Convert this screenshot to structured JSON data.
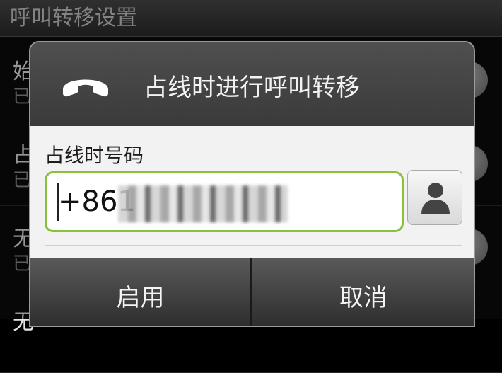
{
  "background": {
    "title": "呼叫转移设置",
    "rows": [
      {
        "title": "始",
        "status": "已"
      },
      {
        "title": "占",
        "status": "已"
      },
      {
        "title": "无",
        "status": "已"
      },
      {
        "title": "无",
        "status": ""
      }
    ]
  },
  "dialog": {
    "title": "占线时进行呼叫转移",
    "field_label": "占线时号码",
    "number_value": "+861",
    "buttons": {
      "enable": "启用",
      "cancel": "取消"
    }
  },
  "colors": {
    "input_border": "#88c13a",
    "header_bg": "#3f3f3f",
    "body_bg": "#f2f2f2"
  },
  "icons": {
    "header": "phone-handset-icon",
    "contact": "person-contact-icon"
  }
}
